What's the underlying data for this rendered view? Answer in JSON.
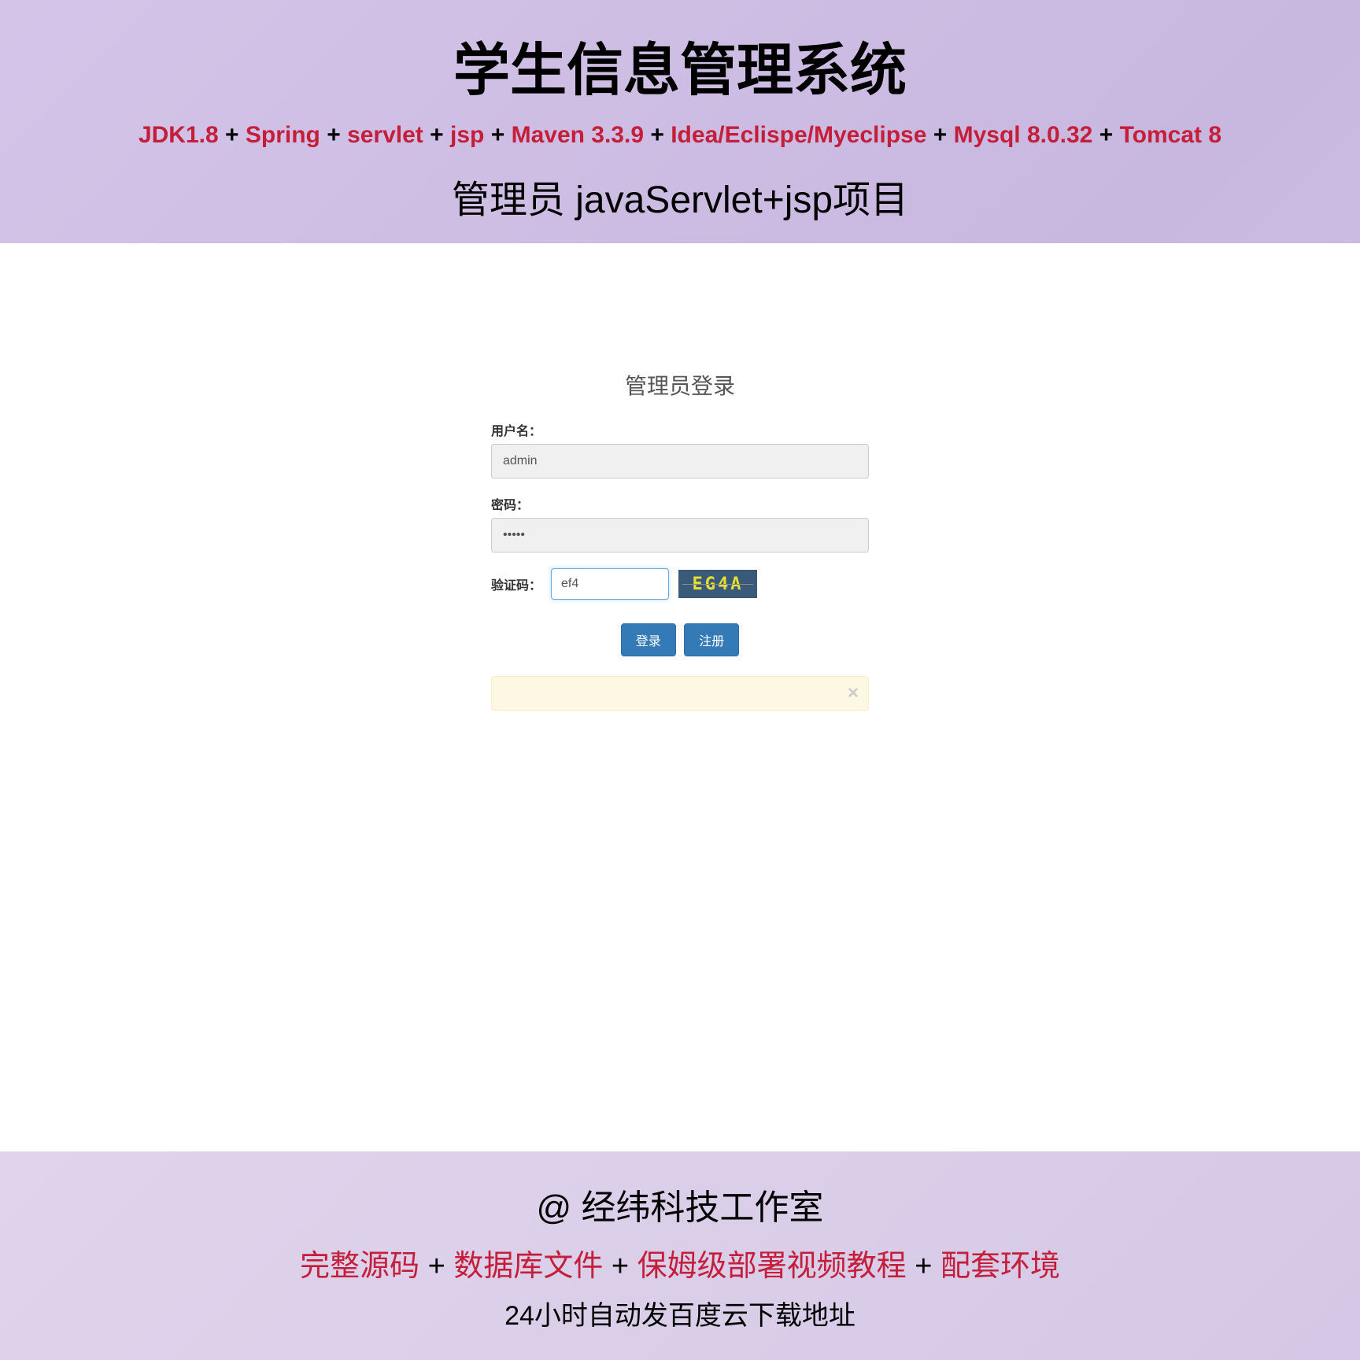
{
  "header": {
    "main_title": "学生信息管理系统",
    "tech_stack": {
      "items": [
        "JDK1.8",
        "Spring",
        "servlet",
        "jsp",
        "Maven 3.3.9",
        "Idea/Eclispe/Myeclipse",
        "Mysql 8.0.32",
        "Tomcat 8"
      ],
      "separator": " + "
    },
    "subtitle": "管理员 javaServlet+jsp项目"
  },
  "login": {
    "title": "管理员登录",
    "username_label": "用户名：",
    "username_value": "admin",
    "password_label": "密码：",
    "password_value": "•••••",
    "captcha_label": "验证码：",
    "captcha_value": "ef4",
    "captcha_image_text": "EG4A",
    "login_button": "登录",
    "register_button": "注册",
    "alert_close": "×"
  },
  "footer": {
    "studio": "@ 经纬科技工作室",
    "items": [
      "完整源码",
      "数据库文件",
      "保姆级部署视频教程",
      "配套环境"
    ],
    "separator": " + ",
    "delivery": "24小时自动发百度云下载地址"
  }
}
